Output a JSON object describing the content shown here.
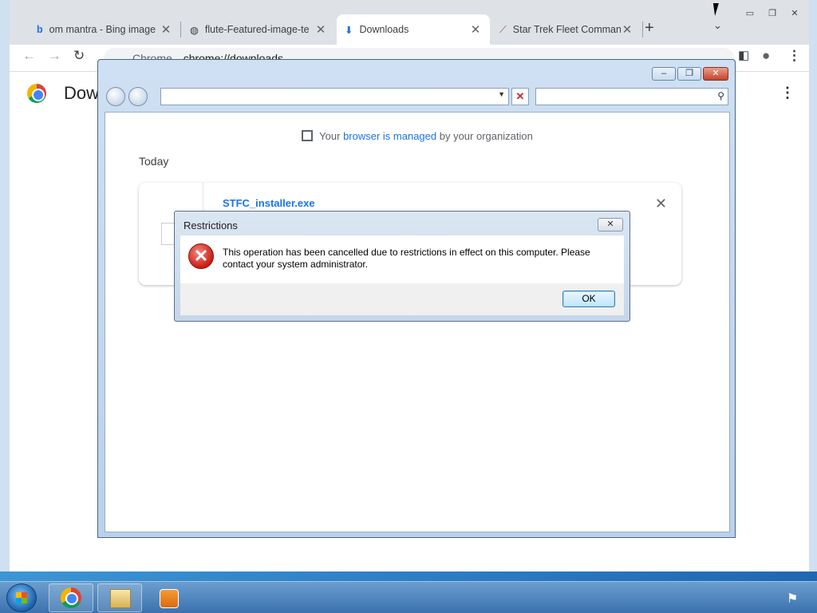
{
  "browser": {
    "tabs": [
      {
        "title": "om mantra - Bing image",
        "icon": "bing-icon"
      },
      {
        "title": "flute-Featured-image-te",
        "icon": "globe-icon"
      },
      {
        "title": "Downloads",
        "icon": "download-icon",
        "active": true
      },
      {
        "title": "Star Trek Fleet Comman",
        "icon": "stfc-icon"
      }
    ],
    "omnibox": {
      "site_chip": "Chrome",
      "url": "chrome://downloads"
    },
    "page_title": "Dow"
  },
  "downloads": {
    "managed_prefix": "Your ",
    "managed_link": "browser is managed",
    "managed_suffix": " by your organization",
    "section_label": "Today",
    "items": [
      {
        "filename": "STFC_installer.exe"
      }
    ]
  },
  "dialog": {
    "title": "Restrictions",
    "message": "This operation has been cancelled due to restrictions in effect on this computer. Please contact your system administrator.",
    "ok_label": "OK",
    "close_glyph": "✕",
    "icon": "error-icon"
  },
  "taskbar": {
    "items": [
      "start-button",
      "chrome-taskbar-button",
      "explorer-taskbar-button",
      "media-player-taskbar-button"
    ],
    "tray_icon": "action-center-flag-icon"
  }
}
